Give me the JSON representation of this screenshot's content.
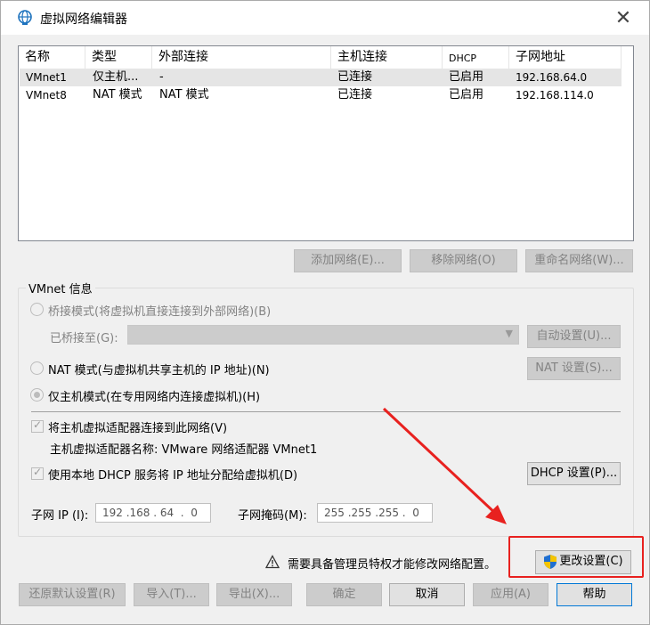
{
  "window": {
    "title": "虚拟网络编辑器",
    "close_glyph": "✕"
  },
  "network_list": {
    "columns": [
      "名称",
      "类型",
      "外部连接",
      "主机连接",
      "DHCP",
      "子网地址"
    ],
    "rows": [
      [
        "VMnet1",
        "仅主机...",
        "-",
        "已连接",
        "已启用",
        "192.168.64.0"
      ],
      [
        "VMnet8",
        "NAT 模式",
        "NAT 模式",
        "已连接",
        "已启用",
        "192.168.114.0"
      ]
    ],
    "selected_row": 0
  },
  "list_buttons": {
    "add": "添加网络(E)...",
    "remove": "移除网络(O)",
    "rename": "重命名网络(W)..."
  },
  "vmnet_info": {
    "group_label": "VMnet 信息",
    "bridged_label": "桥接模式(将虚拟机直接连接到外部网络)(B)",
    "bridged_to_label": "已桥接至(G):",
    "bridged_to_value": "",
    "auto_settings": "自动设置(U)...",
    "nat_label": "NAT 模式(与虚拟机共享主机的 IP 地址)(N)",
    "nat_settings": "NAT 设置(S)...",
    "host_only_label": "仅主机模式(在专用网络内连接虚拟机)(H)",
    "mode_selected": "host_only",
    "connect_adapter_label": "将主机虚拟适配器连接到此网络(V)",
    "connect_adapter_checked": true,
    "adapter_name_label": "主机虚拟适配器名称: VMware 网络适配器 VMnet1",
    "dhcp_label": "使用本地 DHCP 服务将 IP 地址分配给虚拟机(D)",
    "dhcp_checked": true,
    "dhcp_settings": "DHCP 设置(P)...",
    "subnet_ip_label": "子网 IP (I):",
    "subnet_ip_value": "192 .168 . 64  .  0",
    "subnet_mask_label": "子网掩码(M):",
    "subnet_mask_value": "255 .255 .255 .  0"
  },
  "admin_notice": {
    "text": "需要具备管理员特权才能修改网络配置。",
    "change_settings": "更改设置(C)"
  },
  "bottom_buttons": {
    "restore_defaults": "还原默认设置(R)",
    "import": "导入(T)...",
    "export": "导出(X)...",
    "ok": "确定",
    "cancel": "取消",
    "apply": "应用(A)",
    "help": "帮助"
  },
  "colors": {
    "highlight": "#e8211f",
    "shield_blue": "#1f6fd0",
    "shield_yellow": "#f5c400"
  }
}
